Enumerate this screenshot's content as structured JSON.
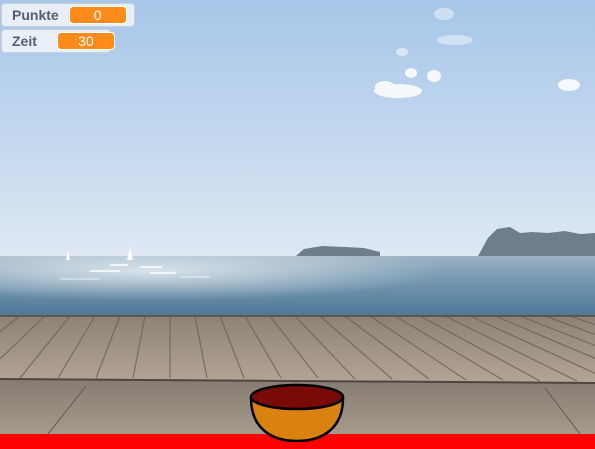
{
  "monitors": {
    "score": {
      "label": "Punkte",
      "value": "0"
    },
    "time": {
      "label": "Zeit",
      "value": "30"
    }
  },
  "scene": {
    "backdrop": "beach boardwalk",
    "sprites": [
      "bowl"
    ],
    "colors": {
      "bottom_bar": "#ff0000",
      "bowl_fill": "#d9820f",
      "bowl_inner": "#7a0a05",
      "monitor_value": "#ff8c1a"
    }
  }
}
